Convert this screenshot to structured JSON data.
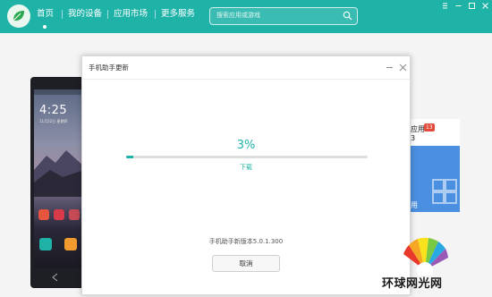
{
  "nav": {
    "items": [
      {
        "label": "首页"
      },
      {
        "label": "我的设备"
      },
      {
        "label": "应用市场"
      },
      {
        "label": "更多服务"
      }
    ],
    "search_placeholder": "搜索应用或游戏"
  },
  "theme": {
    "accent": "#1fb3a8",
    "badge": "#e24b3b",
    "card": "#4b8fe0"
  },
  "phone": {
    "clock": "4:25",
    "date": "11月22日 星期四"
  },
  "background_card": {
    "line1": "应用",
    "badge": "13",
    "line2": "3",
    "line3": "用"
  },
  "dialog": {
    "title": "手机助手更新",
    "percent_text": "3%",
    "progress": 0.03,
    "progress_label": "下载",
    "version_text": "手机助手新版本5.0.1.300",
    "cancel_label": "取消"
  },
  "watermark": {
    "text": "环球网光网"
  }
}
